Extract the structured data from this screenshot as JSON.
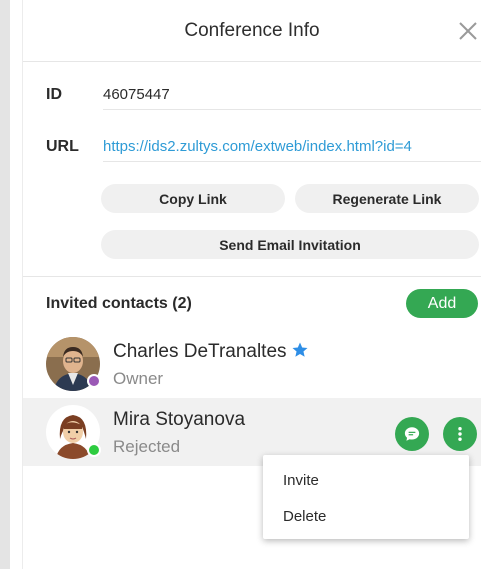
{
  "header": {
    "title": "Conference Info"
  },
  "fields": {
    "id_label": "ID",
    "id_value": "46075447",
    "url_label": "URL",
    "url_value": "https://ids2.zultys.com/extweb/index.html?id=4"
  },
  "actions": {
    "copy_link": "Copy Link",
    "regenerate_link": "Regenerate Link",
    "send_email": "Send Email Invitation"
  },
  "invited": {
    "label": "Invited contacts (2)",
    "add_label": "Add",
    "contacts": [
      {
        "name": "Charles DeTranaltes",
        "role": "Owner",
        "favorite": true,
        "presence_color": "#9b59b6"
      },
      {
        "name": "Mira Stoyanova",
        "role": "Rejected",
        "favorite": false,
        "presence_color": "#2ecc40"
      }
    ]
  },
  "context_menu": {
    "items": [
      "Invite",
      "Delete"
    ]
  },
  "colors": {
    "accent": "#34a853",
    "link": "#2e9bd6",
    "star": "#2e8ee6"
  },
  "icons": [
    "close-icon",
    "star-icon",
    "chat-icon",
    "more-vertical-icon"
  ]
}
